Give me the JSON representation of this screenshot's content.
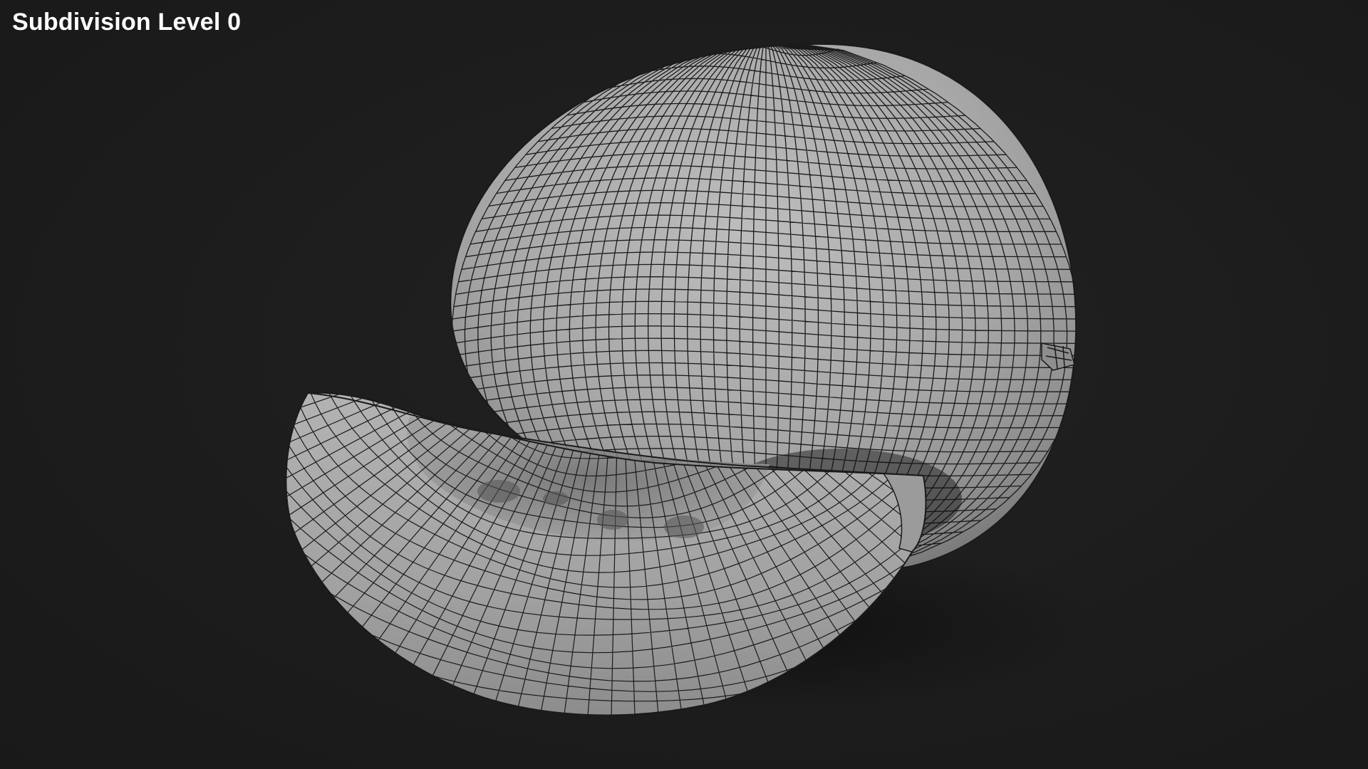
{
  "viewport": {
    "label": "Subdivision Level 0"
  },
  "colors": {
    "background": "#1d1d1d",
    "mesh_fill": "#a9a9a9",
    "wire": "#1a1a1a",
    "label": "#ffffff"
  },
  "objects": [
    "melon-whole-mesh",
    "melon-slice-mesh"
  ]
}
